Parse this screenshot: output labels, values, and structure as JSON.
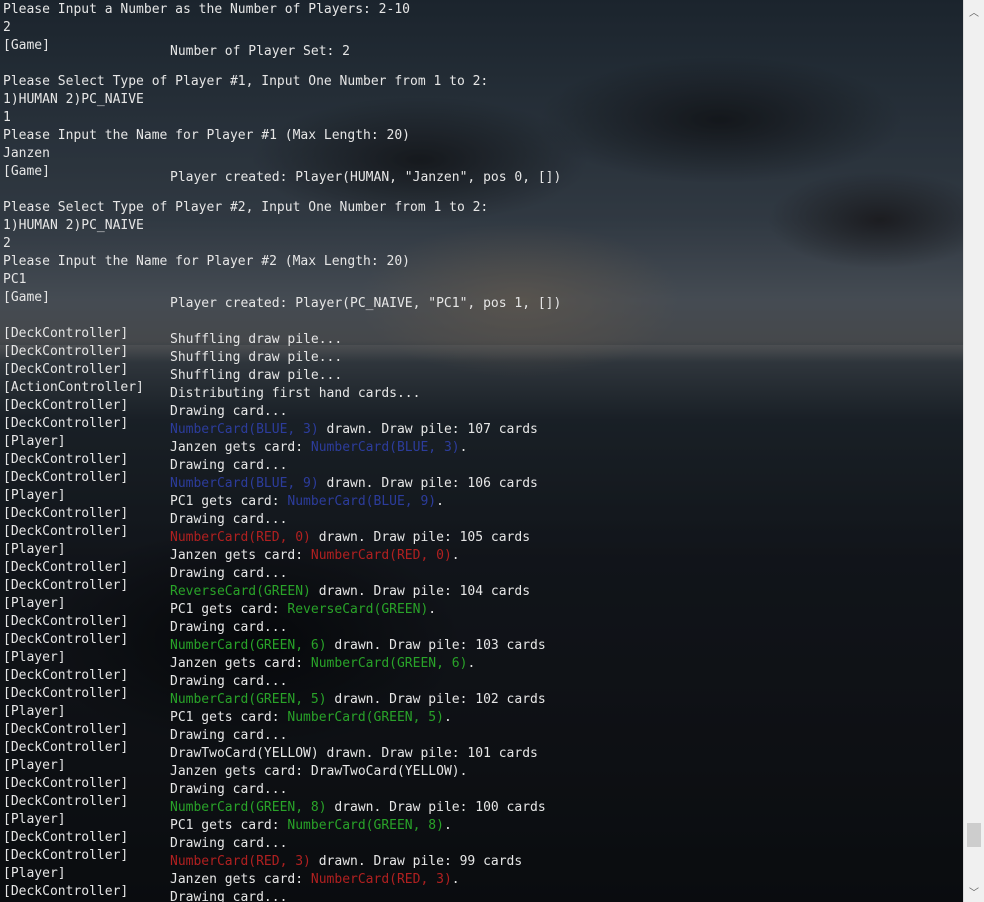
{
  "colors": {
    "default": "#e6e6e6",
    "blue": "#2c3c9c",
    "red": "#b02020",
    "green": "#29a329",
    "yellow": "#e6e6e6"
  },
  "icons": {
    "scroll_up": "chevron-up-icon",
    "scroll_down": "chevron-down-icon"
  },
  "scroll": {
    "up_glyph": "︿",
    "down_glyph": "﹀",
    "position_fraction": 0.96
  },
  "console_lines": [
    {
      "kind": "plain",
      "text": "Please Input a Number as the Number of Players: 2-10"
    },
    {
      "kind": "plain",
      "text": "2"
    },
    {
      "kind": "log",
      "tag": "[Game]",
      "segments": [
        {
          "text": "Number of Player Set: 2"
        }
      ]
    },
    {
      "kind": "plain",
      "text": ""
    },
    {
      "kind": "plain",
      "text": "Please Select Type of Player #1, Input One Number from 1 to 2:"
    },
    {
      "kind": "plain",
      "text": "1)HUMAN 2)PC_NAIVE"
    },
    {
      "kind": "plain",
      "text": "1"
    },
    {
      "kind": "plain",
      "text": "Please Input the Name for Player #1 (Max Length: 20)"
    },
    {
      "kind": "plain",
      "text": "Janzen"
    },
    {
      "kind": "log",
      "tag": "[Game]",
      "segments": [
        {
          "text": "Player created: Player(HUMAN, \"Janzen\", pos 0, [])"
        }
      ]
    },
    {
      "kind": "plain",
      "text": ""
    },
    {
      "kind": "plain",
      "text": "Please Select Type of Player #2, Input One Number from 1 to 2:"
    },
    {
      "kind": "plain",
      "text": "1)HUMAN 2)PC_NAIVE"
    },
    {
      "kind": "plain",
      "text": "2"
    },
    {
      "kind": "plain",
      "text": "Please Input the Name for Player #2 (Max Length: 20)"
    },
    {
      "kind": "plain",
      "text": "PC1"
    },
    {
      "kind": "log",
      "tag": "[Game]",
      "segments": [
        {
          "text": "Player created: Player(PC_NAIVE, \"PC1\", pos 1, [])"
        }
      ]
    },
    {
      "kind": "plain",
      "text": ""
    },
    {
      "kind": "log",
      "tag": "[DeckController]",
      "segments": [
        {
          "text": "Shuffling draw pile..."
        }
      ]
    },
    {
      "kind": "log",
      "tag": "[DeckController]",
      "segments": [
        {
          "text": "Shuffling draw pile..."
        }
      ]
    },
    {
      "kind": "log",
      "tag": "[DeckController]",
      "segments": [
        {
          "text": "Shuffling draw pile..."
        }
      ]
    },
    {
      "kind": "log",
      "tag": "[ActionController]",
      "segments": [
        {
          "text": "Distributing first hand cards..."
        }
      ]
    },
    {
      "kind": "log",
      "tag": "[DeckController]",
      "segments": [
        {
          "text": "Drawing card..."
        }
      ]
    },
    {
      "kind": "log",
      "tag": "[DeckController]",
      "segments": [
        {
          "text": "NumberCard(BLUE, 3)",
          "color": "blue"
        },
        {
          "text": " drawn. Draw pile: 107 cards"
        }
      ]
    },
    {
      "kind": "log",
      "tag": "[Player]",
      "segments": [
        {
          "text": "Janzen gets card: "
        },
        {
          "text": "NumberCard(BLUE, 3)",
          "color": "blue"
        },
        {
          "text": "."
        }
      ]
    },
    {
      "kind": "log",
      "tag": "[DeckController]",
      "segments": [
        {
          "text": "Drawing card..."
        }
      ]
    },
    {
      "kind": "log",
      "tag": "[DeckController]",
      "segments": [
        {
          "text": "NumberCard(BLUE, 9)",
          "color": "blue"
        },
        {
          "text": " drawn. Draw pile: 106 cards"
        }
      ]
    },
    {
      "kind": "log",
      "tag": "[Player]",
      "segments": [
        {
          "text": "PC1 gets card: "
        },
        {
          "text": "NumberCard(BLUE, 9)",
          "color": "blue"
        },
        {
          "text": "."
        }
      ]
    },
    {
      "kind": "log",
      "tag": "[DeckController]",
      "segments": [
        {
          "text": "Drawing card..."
        }
      ]
    },
    {
      "kind": "log",
      "tag": "[DeckController]",
      "segments": [
        {
          "text": "NumberCard(RED, 0)",
          "color": "red"
        },
        {
          "text": " drawn. Draw pile: 105 cards"
        }
      ]
    },
    {
      "kind": "log",
      "tag": "[Player]",
      "segments": [
        {
          "text": "Janzen gets card: "
        },
        {
          "text": "NumberCard(RED, 0)",
          "color": "red"
        },
        {
          "text": "."
        }
      ]
    },
    {
      "kind": "log",
      "tag": "[DeckController]",
      "segments": [
        {
          "text": "Drawing card..."
        }
      ]
    },
    {
      "kind": "log",
      "tag": "[DeckController]",
      "segments": [
        {
          "text": "ReverseCard(GREEN)",
          "color": "green"
        },
        {
          "text": " drawn. Draw pile: 104 cards"
        }
      ]
    },
    {
      "kind": "log",
      "tag": "[Player]",
      "segments": [
        {
          "text": "PC1 gets card: "
        },
        {
          "text": "ReverseCard(GREEN)",
          "color": "green"
        },
        {
          "text": "."
        }
      ]
    },
    {
      "kind": "log",
      "tag": "[DeckController]",
      "segments": [
        {
          "text": "Drawing card..."
        }
      ]
    },
    {
      "kind": "log",
      "tag": "[DeckController]",
      "segments": [
        {
          "text": "NumberCard(GREEN, 6)",
          "color": "green"
        },
        {
          "text": " drawn. Draw pile: 103 cards"
        }
      ]
    },
    {
      "kind": "log",
      "tag": "[Player]",
      "segments": [
        {
          "text": "Janzen gets card: "
        },
        {
          "text": "NumberCard(GREEN, 6)",
          "color": "green"
        },
        {
          "text": "."
        }
      ]
    },
    {
      "kind": "log",
      "tag": "[DeckController]",
      "segments": [
        {
          "text": "Drawing card..."
        }
      ]
    },
    {
      "kind": "log",
      "tag": "[DeckController]",
      "segments": [
        {
          "text": "NumberCard(GREEN, 5)",
          "color": "green"
        },
        {
          "text": " drawn. Draw pile: 102 cards"
        }
      ]
    },
    {
      "kind": "log",
      "tag": "[Player]",
      "segments": [
        {
          "text": "PC1 gets card: "
        },
        {
          "text": "NumberCard(GREEN, 5)",
          "color": "green"
        },
        {
          "text": "."
        }
      ]
    },
    {
      "kind": "log",
      "tag": "[DeckController]",
      "segments": [
        {
          "text": "Drawing card..."
        }
      ]
    },
    {
      "kind": "log",
      "tag": "[DeckController]",
      "segments": [
        {
          "text": "DrawTwoCard(YELLOW)",
          "color": "yellow"
        },
        {
          "text": " drawn. Draw pile: 101 cards"
        }
      ]
    },
    {
      "kind": "log",
      "tag": "[Player]",
      "segments": [
        {
          "text": "Janzen gets card: "
        },
        {
          "text": "DrawTwoCard(YELLOW)",
          "color": "yellow"
        },
        {
          "text": "."
        }
      ]
    },
    {
      "kind": "log",
      "tag": "[DeckController]",
      "segments": [
        {
          "text": "Drawing card..."
        }
      ]
    },
    {
      "kind": "log",
      "tag": "[DeckController]",
      "segments": [
        {
          "text": "NumberCard(GREEN, 8)",
          "color": "green"
        },
        {
          "text": " drawn. Draw pile: 100 cards"
        }
      ]
    },
    {
      "kind": "log",
      "tag": "[Player]",
      "segments": [
        {
          "text": "PC1 gets card: "
        },
        {
          "text": "NumberCard(GREEN, 8)",
          "color": "green"
        },
        {
          "text": "."
        }
      ]
    },
    {
      "kind": "log",
      "tag": "[DeckController]",
      "segments": [
        {
          "text": "Drawing card..."
        }
      ]
    },
    {
      "kind": "log",
      "tag": "[DeckController]",
      "segments": [
        {
          "text": "NumberCard(RED, 3)",
          "color": "red"
        },
        {
          "text": " drawn. Draw pile: 99 cards"
        }
      ]
    },
    {
      "kind": "log",
      "tag": "[Player]",
      "segments": [
        {
          "text": "Janzen gets card: "
        },
        {
          "text": "NumberCard(RED, 3)",
          "color": "red"
        },
        {
          "text": "."
        }
      ]
    },
    {
      "kind": "log",
      "tag": "[DeckController]",
      "segments": [
        {
          "text": "Drawing card..."
        }
      ]
    }
  ]
}
